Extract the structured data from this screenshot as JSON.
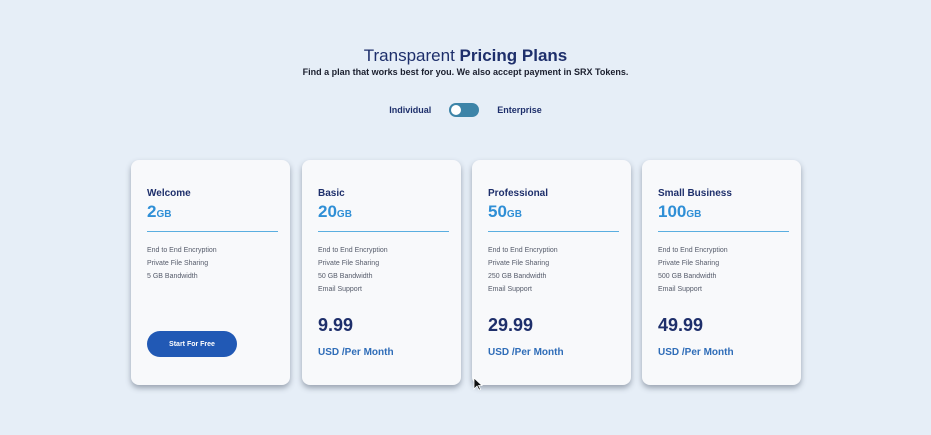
{
  "header": {
    "title_light": "Transparent",
    "title_bold": "Pricing Plans",
    "subtitle": "Find a plan that works best for you. We also accept payment in SRX Tokens."
  },
  "toggle": {
    "left_label": "Individual",
    "right_label": "Enterprise"
  },
  "plans": [
    {
      "name": "Welcome",
      "storage_value": "2",
      "storage_unit": "GB",
      "features": [
        "End to End Encryption",
        "Private File Sharing",
        "5 GB Bandwidth"
      ],
      "cta_label": "Start For Free"
    },
    {
      "name": "Basic",
      "storage_value": "20",
      "storage_unit": "GB",
      "features": [
        "End to End Encryption",
        "Private File Sharing",
        "50 GB Bandwidth",
        "Email Support"
      ],
      "price": "9.99",
      "period": "USD /Per Month"
    },
    {
      "name": "Professional",
      "storage_value": "50",
      "storage_unit": "GB",
      "features": [
        "End to End Encryption",
        "Private File Sharing",
        "250 GB Bandwidth",
        "Email Support"
      ],
      "price": "29.99",
      "period": "USD /Per Month"
    },
    {
      "name": "Small Business",
      "storage_value": "100",
      "storage_unit": "GB",
      "features": [
        "End to End Encryption",
        "Private File Sharing",
        "500 GB Bandwidth",
        "Email Support"
      ],
      "price": "49.99",
      "period": "USD /Per Month"
    }
  ],
  "colors": {
    "background": "#e6eef7",
    "card": "#f8f9fb",
    "navy": "#1e2f6b",
    "accent_blue": "#2f8fd6",
    "button": "#2159b5",
    "toggle": "#3d84a8"
  }
}
